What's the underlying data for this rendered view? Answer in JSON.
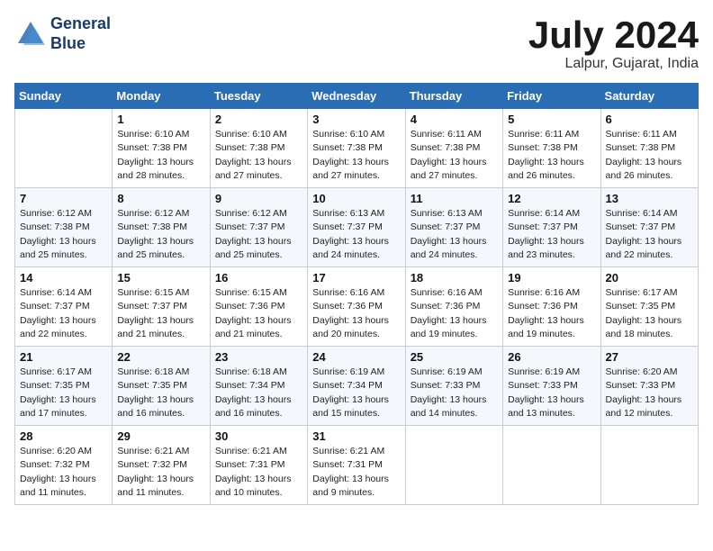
{
  "header": {
    "logo_line1": "General",
    "logo_line2": "Blue",
    "month_title": "July 2024",
    "location": "Lalpur, Gujarat, India"
  },
  "weekdays": [
    "Sunday",
    "Monday",
    "Tuesday",
    "Wednesday",
    "Thursday",
    "Friday",
    "Saturday"
  ],
  "weeks": [
    [
      {
        "day": "",
        "sunrise": "",
        "sunset": "",
        "daylight": ""
      },
      {
        "day": "1",
        "sunrise": "Sunrise: 6:10 AM",
        "sunset": "Sunset: 7:38 PM",
        "daylight": "Daylight: 13 hours and 28 minutes."
      },
      {
        "day": "2",
        "sunrise": "Sunrise: 6:10 AM",
        "sunset": "Sunset: 7:38 PM",
        "daylight": "Daylight: 13 hours and 27 minutes."
      },
      {
        "day": "3",
        "sunrise": "Sunrise: 6:10 AM",
        "sunset": "Sunset: 7:38 PM",
        "daylight": "Daylight: 13 hours and 27 minutes."
      },
      {
        "day": "4",
        "sunrise": "Sunrise: 6:11 AM",
        "sunset": "Sunset: 7:38 PM",
        "daylight": "Daylight: 13 hours and 27 minutes."
      },
      {
        "day": "5",
        "sunrise": "Sunrise: 6:11 AM",
        "sunset": "Sunset: 7:38 PM",
        "daylight": "Daylight: 13 hours and 26 minutes."
      },
      {
        "day": "6",
        "sunrise": "Sunrise: 6:11 AM",
        "sunset": "Sunset: 7:38 PM",
        "daylight": "Daylight: 13 hours and 26 minutes."
      }
    ],
    [
      {
        "day": "7",
        "sunrise": "Sunrise: 6:12 AM",
        "sunset": "Sunset: 7:38 PM",
        "daylight": "Daylight: 13 hours and 25 minutes."
      },
      {
        "day": "8",
        "sunrise": "Sunrise: 6:12 AM",
        "sunset": "Sunset: 7:38 PM",
        "daylight": "Daylight: 13 hours and 25 minutes."
      },
      {
        "day": "9",
        "sunrise": "Sunrise: 6:12 AM",
        "sunset": "Sunset: 7:37 PM",
        "daylight": "Daylight: 13 hours and 25 minutes."
      },
      {
        "day": "10",
        "sunrise": "Sunrise: 6:13 AM",
        "sunset": "Sunset: 7:37 PM",
        "daylight": "Daylight: 13 hours and 24 minutes."
      },
      {
        "day": "11",
        "sunrise": "Sunrise: 6:13 AM",
        "sunset": "Sunset: 7:37 PM",
        "daylight": "Daylight: 13 hours and 24 minutes."
      },
      {
        "day": "12",
        "sunrise": "Sunrise: 6:14 AM",
        "sunset": "Sunset: 7:37 PM",
        "daylight": "Daylight: 13 hours and 23 minutes."
      },
      {
        "day": "13",
        "sunrise": "Sunrise: 6:14 AM",
        "sunset": "Sunset: 7:37 PM",
        "daylight": "Daylight: 13 hours and 22 minutes."
      }
    ],
    [
      {
        "day": "14",
        "sunrise": "Sunrise: 6:14 AM",
        "sunset": "Sunset: 7:37 PM",
        "daylight": "Daylight: 13 hours and 22 minutes."
      },
      {
        "day": "15",
        "sunrise": "Sunrise: 6:15 AM",
        "sunset": "Sunset: 7:37 PM",
        "daylight": "Daylight: 13 hours and 21 minutes."
      },
      {
        "day": "16",
        "sunrise": "Sunrise: 6:15 AM",
        "sunset": "Sunset: 7:36 PM",
        "daylight": "Daylight: 13 hours and 21 minutes."
      },
      {
        "day": "17",
        "sunrise": "Sunrise: 6:16 AM",
        "sunset": "Sunset: 7:36 PM",
        "daylight": "Daylight: 13 hours and 20 minutes."
      },
      {
        "day": "18",
        "sunrise": "Sunrise: 6:16 AM",
        "sunset": "Sunset: 7:36 PM",
        "daylight": "Daylight: 13 hours and 19 minutes."
      },
      {
        "day": "19",
        "sunrise": "Sunrise: 6:16 AM",
        "sunset": "Sunset: 7:36 PM",
        "daylight": "Daylight: 13 hours and 19 minutes."
      },
      {
        "day": "20",
        "sunrise": "Sunrise: 6:17 AM",
        "sunset": "Sunset: 7:35 PM",
        "daylight": "Daylight: 13 hours and 18 minutes."
      }
    ],
    [
      {
        "day": "21",
        "sunrise": "Sunrise: 6:17 AM",
        "sunset": "Sunset: 7:35 PM",
        "daylight": "Daylight: 13 hours and 17 minutes."
      },
      {
        "day": "22",
        "sunrise": "Sunrise: 6:18 AM",
        "sunset": "Sunset: 7:35 PM",
        "daylight": "Daylight: 13 hours and 16 minutes."
      },
      {
        "day": "23",
        "sunrise": "Sunrise: 6:18 AM",
        "sunset": "Sunset: 7:34 PM",
        "daylight": "Daylight: 13 hours and 16 minutes."
      },
      {
        "day": "24",
        "sunrise": "Sunrise: 6:19 AM",
        "sunset": "Sunset: 7:34 PM",
        "daylight": "Daylight: 13 hours and 15 minutes."
      },
      {
        "day": "25",
        "sunrise": "Sunrise: 6:19 AM",
        "sunset": "Sunset: 7:33 PM",
        "daylight": "Daylight: 13 hours and 14 minutes."
      },
      {
        "day": "26",
        "sunrise": "Sunrise: 6:19 AM",
        "sunset": "Sunset: 7:33 PM",
        "daylight": "Daylight: 13 hours and 13 minutes."
      },
      {
        "day": "27",
        "sunrise": "Sunrise: 6:20 AM",
        "sunset": "Sunset: 7:33 PM",
        "daylight": "Daylight: 13 hours and 12 minutes."
      }
    ],
    [
      {
        "day": "28",
        "sunrise": "Sunrise: 6:20 AM",
        "sunset": "Sunset: 7:32 PM",
        "daylight": "Daylight: 13 hours and 11 minutes."
      },
      {
        "day": "29",
        "sunrise": "Sunrise: 6:21 AM",
        "sunset": "Sunset: 7:32 PM",
        "daylight": "Daylight: 13 hours and 11 minutes."
      },
      {
        "day": "30",
        "sunrise": "Sunrise: 6:21 AM",
        "sunset": "Sunset: 7:31 PM",
        "daylight": "Daylight: 13 hours and 10 minutes."
      },
      {
        "day": "31",
        "sunrise": "Sunrise: 6:21 AM",
        "sunset": "Sunset: 7:31 PM",
        "daylight": "Daylight: 13 hours and 9 minutes."
      },
      {
        "day": "",
        "sunrise": "",
        "sunset": "",
        "daylight": ""
      },
      {
        "day": "",
        "sunrise": "",
        "sunset": "",
        "daylight": ""
      },
      {
        "day": "",
        "sunrise": "",
        "sunset": "",
        "daylight": ""
      }
    ]
  ]
}
